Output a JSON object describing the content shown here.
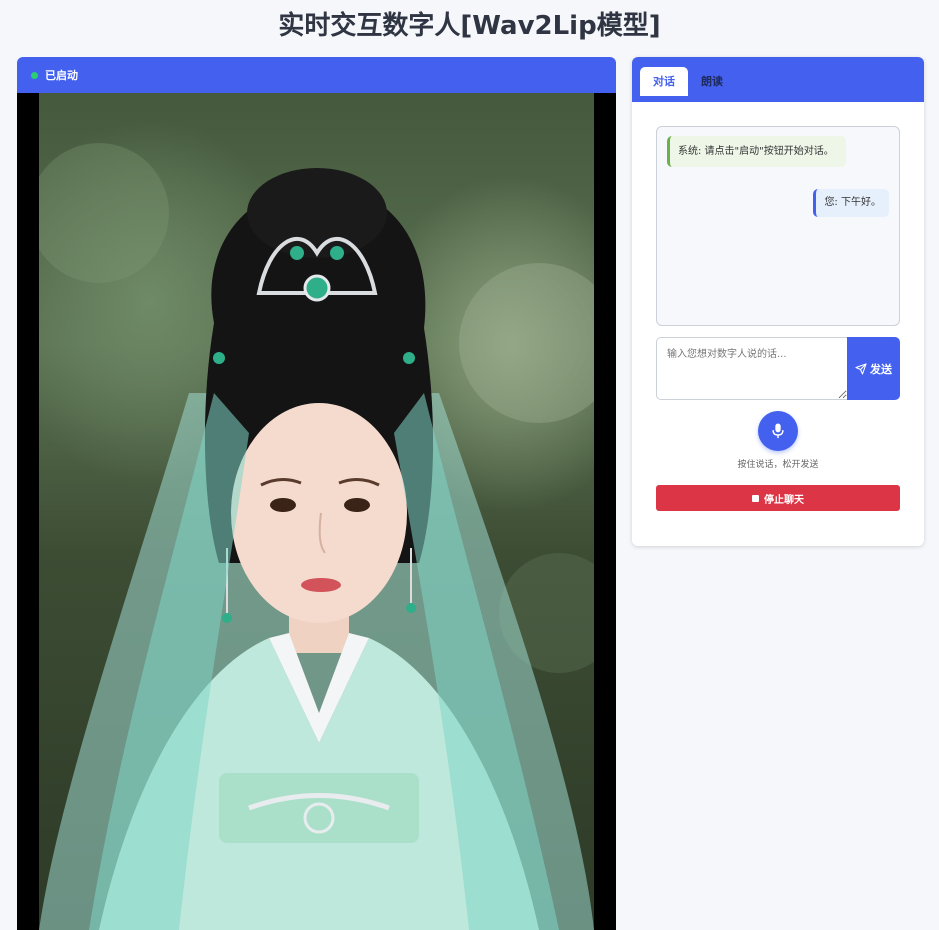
{
  "page": {
    "title": "实时交互数字人[Wav2Lip模型]"
  },
  "status": {
    "text": "已启动",
    "dot_color": "#2ecc71"
  },
  "video": {
    "subject": "digital human avatar in light green hanfu with silver headdress"
  },
  "chat": {
    "tabs": [
      {
        "label": "对话",
        "active": true
      },
      {
        "label": "朗读",
        "active": false
      }
    ],
    "messages": [
      {
        "role": "system",
        "text": "系统: 请点击\"启动\"按钮开始对话。"
      },
      {
        "role": "user",
        "text": "您: 下午好。"
      }
    ],
    "input": {
      "placeholder": "输入您想对数字人说的话...",
      "value": ""
    },
    "send_label": "发送",
    "mic_hint": "按住说话，松开发送",
    "stop_label": "停止聊天"
  },
  "colors": {
    "accent": "#4361ee",
    "danger": "#dc3545",
    "background": "#f5f7fb"
  },
  "icons": [
    "status-dot",
    "send-icon",
    "microphone-icon",
    "stop-icon"
  ]
}
